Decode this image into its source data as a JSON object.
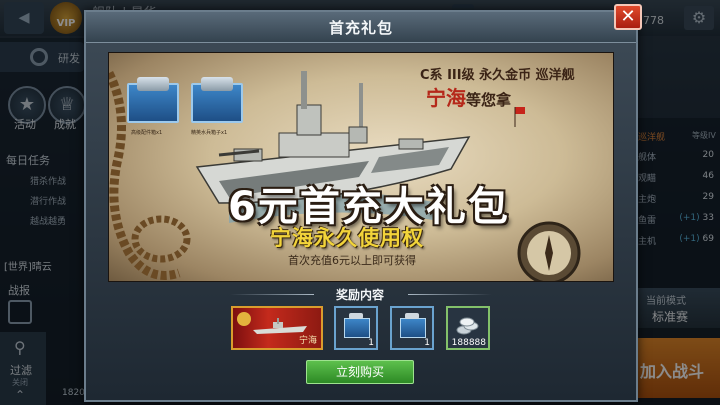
{
  "background": {
    "player_name": "舰队 | 星华",
    "vip_label": "VIP",
    "currency": "1778",
    "research_label": "研发",
    "activity_label": "活动",
    "achievement_label": "成就",
    "daily_tasks_title": "每日任务",
    "tasks": [
      "猎杀作战",
      "潜行作战",
      "越战越勇"
    ],
    "chat_text": "[世界]晴云",
    "battle_report_label": "战报",
    "filter_label": "过滤",
    "filter_state": "关闭",
    "ship_class": "巡洋舰",
    "ship_level": "等级IV",
    "stats": [
      {
        "label": "舰体",
        "value": "20",
        "bonus": ""
      },
      {
        "label": "观瞄",
        "value": "46",
        "bonus": ""
      },
      {
        "label": "主炮",
        "value": "29",
        "bonus": ""
      },
      {
        "label": "鱼雷",
        "value": "33",
        "bonus": "(+1)"
      },
      {
        "label": "主机",
        "value": "69",
        "bonus": "(+1)"
      }
    ],
    "mode_label": "当前模式",
    "mode_value": "标准赛",
    "join_battle": "加入战斗",
    "bottom_number": "1820"
  },
  "modal": {
    "title": "首充礼包",
    "close_symbol": "✕",
    "banner": {
      "item1_label": "高级配件箱x1",
      "item2_label": "精英水兵箱子x1",
      "caption_line1": "C系 III级 永久金币 巡洋舰",
      "caption_ship": "宁海",
      "caption_waiting": "等您拿",
      "headline": "6元首充大礼包",
      "subheadline": "宁海永久使用权",
      "note": "首次充值6元以上即可获得"
    },
    "rewards_title": "奖励内容",
    "rewards": [
      {
        "type": "ship",
        "name": "宁海",
        "count": ""
      },
      {
        "type": "box",
        "name": "高级配件箱",
        "count": "1"
      },
      {
        "type": "box",
        "name": "精英水兵箱子",
        "count": "1"
      },
      {
        "type": "silver",
        "name": "银币",
        "count": "188888"
      }
    ],
    "buy_button": "立刻购买"
  },
  "colors": {
    "close_red": "#c0311d",
    "buy_green": "#3fa233",
    "accent_orange": "#e58a2a",
    "headline_yellow": "#f2d43a"
  }
}
